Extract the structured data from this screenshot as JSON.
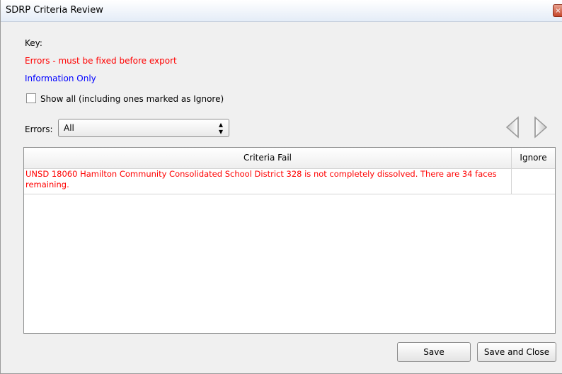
{
  "window": {
    "title": "SDRP Criteria Review",
    "close_glyph": "×"
  },
  "key": {
    "label": "Key:",
    "errors_text": "Errors - must be fixed before export",
    "info_text": "Information Only",
    "errors_color": "#ff0000",
    "info_color": "#0000ff"
  },
  "show_all": {
    "label": "Show all (including ones marked as Ignore)",
    "checked": false
  },
  "filter": {
    "label": "Errors:",
    "selected": "All",
    "arrow_glyph": "▲▼"
  },
  "nav": {
    "prev_icon": "triangle-left-icon",
    "next_icon": "triangle-right-icon"
  },
  "table": {
    "columns": [
      "Criteria Fail",
      "Ignore"
    ],
    "rows": [
      {
        "criteria": "UNSD 18060 Hamilton Community Consolidated School District 328 is not completely dissolved. There are 34 faces remaining.",
        "ignore": ""
      }
    ]
  },
  "buttons": {
    "save": "Save",
    "save_and_close": "Save and Close"
  }
}
